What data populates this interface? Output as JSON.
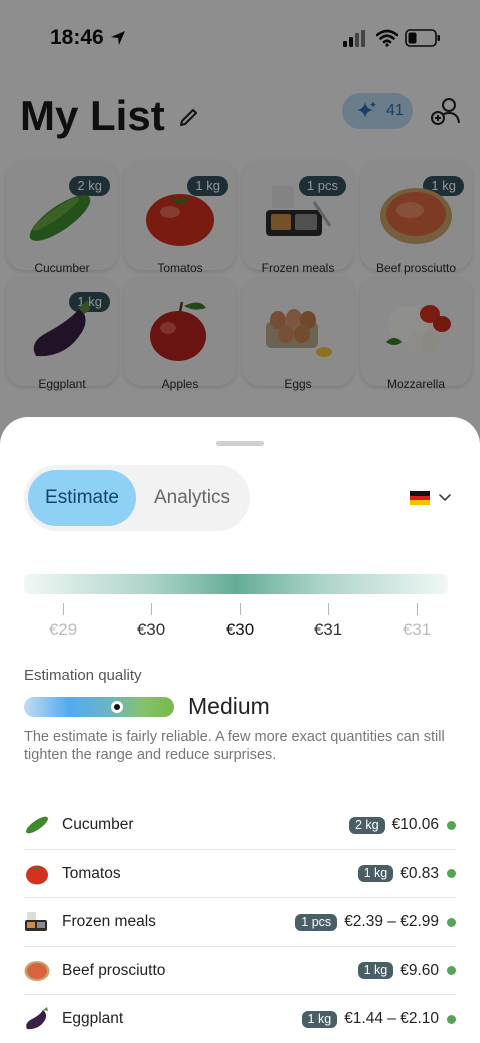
{
  "status_bar": {
    "time": "18:46"
  },
  "header": {
    "title": "My List",
    "credits": "41"
  },
  "grid_items": [
    {
      "name": "Cucumber",
      "qty": "2 kg",
      "icon": "cucumber-icon"
    },
    {
      "name": "Tomatos",
      "qty": "1 kg",
      "icon": "tomato-icon"
    },
    {
      "name": "Frozen meals",
      "qty": "1 pcs",
      "icon": "frozen-meal-icon"
    },
    {
      "name": "Beef prosciutto",
      "qty": "1 kg",
      "icon": "prosciutto-icon"
    },
    {
      "name": "Eggplant",
      "qty": "1 kg",
      "icon": "eggplant-icon"
    },
    {
      "name": "Apples",
      "qty": "",
      "icon": "apple-icon"
    },
    {
      "name": "Eggs",
      "qty": "",
      "icon": "eggs-icon"
    },
    {
      "name": "Mozzarella",
      "qty": "",
      "icon": "mozzarella-icon"
    }
  ],
  "sheet": {
    "tabs": {
      "estimate": "Estimate",
      "analytics": "Analytics"
    },
    "selected_tab": "Estimate",
    "country_flag": "germany-flag-icon",
    "range_labels": [
      "€29",
      "€30",
      "€30",
      "€31",
      "€31"
    ],
    "quality": {
      "label": "Estimation quality",
      "value": "Medium",
      "level": 0.62,
      "description": "The estimate is fairly reliable. A few more exact quantities can still tighten the range and reduce surprises."
    },
    "items": [
      {
        "name": "Cucumber",
        "qty": "2 kg",
        "price": "€10.06",
        "icon": "cucumber-icon"
      },
      {
        "name": "Tomatos",
        "qty": "1 kg",
        "price": "€0.83",
        "icon": "tomato-icon"
      },
      {
        "name": "Frozen meals",
        "qty": "1 pcs",
        "price": "€2.39 – €2.99",
        "icon": "frozen-meal-icon"
      },
      {
        "name": "Beef prosciutto",
        "qty": "1 kg",
        "price": "€9.60",
        "icon": "prosciutto-icon"
      },
      {
        "name": "Eggplant",
        "qty": "1 kg",
        "price": "€1.44 – €2.10",
        "icon": "eggplant-icon"
      }
    ]
  },
  "colors": {
    "accent_tab": "#8fd0f5",
    "badge": "#4a5e66",
    "status_dot": "#58a35a",
    "range_center": "#5ca892"
  }
}
